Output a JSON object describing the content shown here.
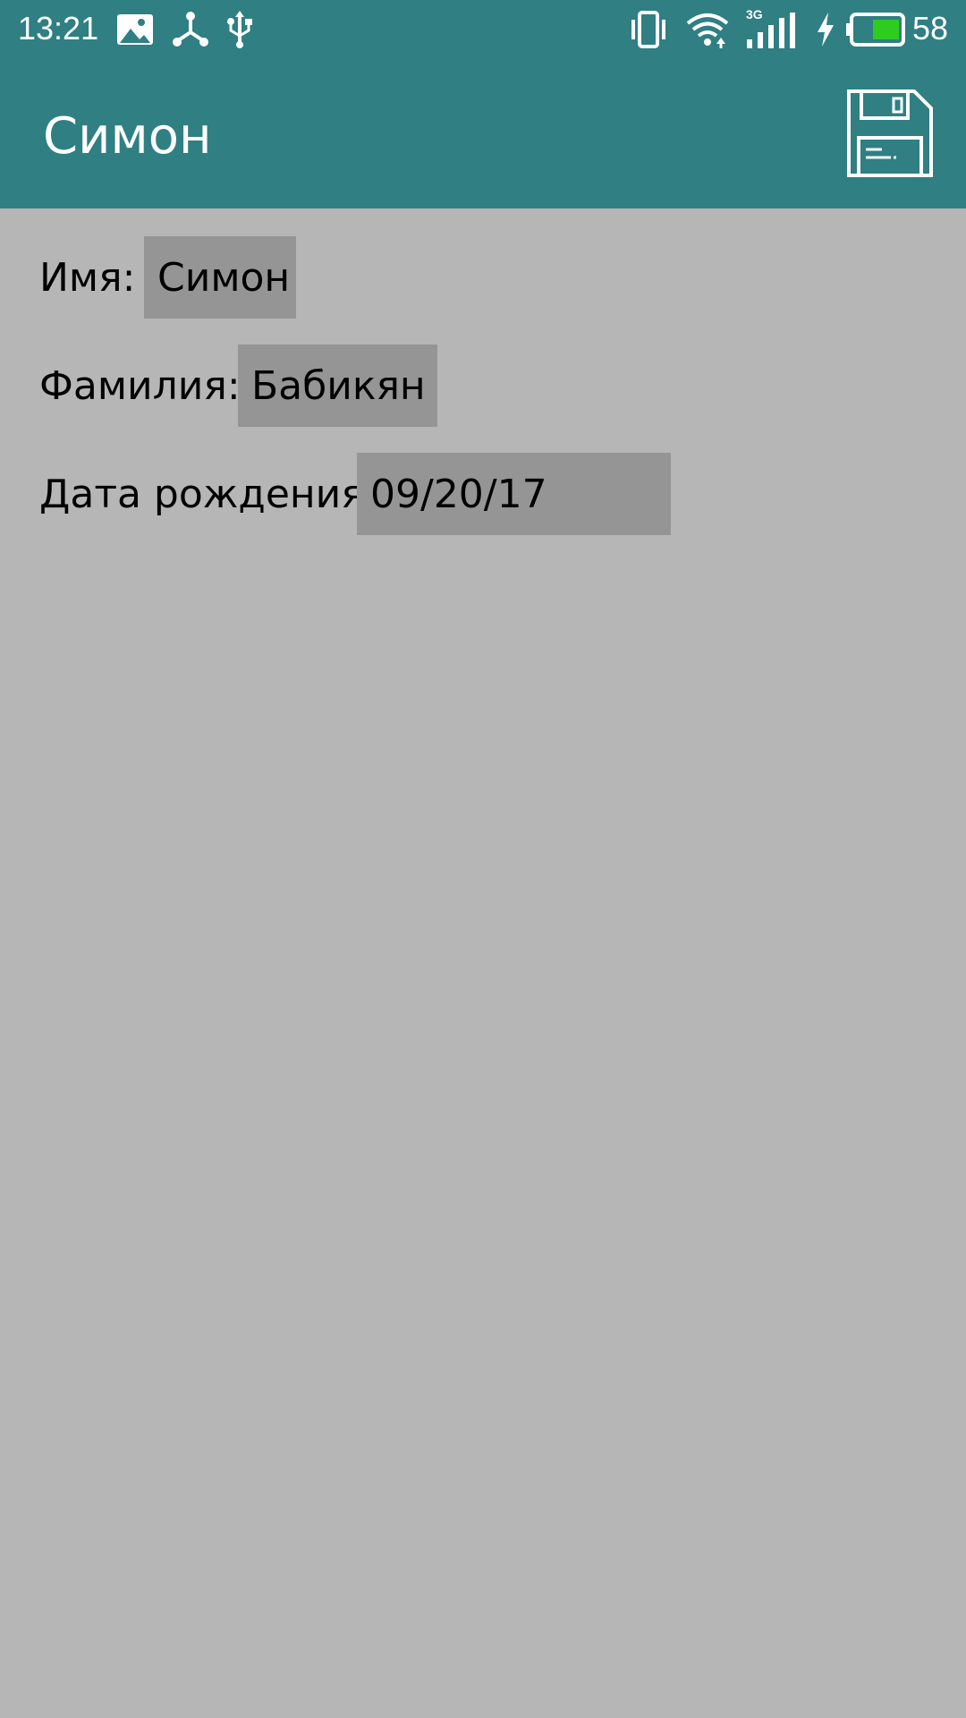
{
  "status_bar": {
    "time": "13:21",
    "network_label": "3G",
    "battery_percent": "58",
    "icons": [
      "image-icon",
      "network-share-icon",
      "usb-icon",
      "vibrate-icon",
      "wifi-icon",
      "signal-icon",
      "charging-icon",
      "battery-icon"
    ]
  },
  "toolbar": {
    "title": "Симон",
    "save_icon": "floppy-disk-icon"
  },
  "form": {
    "first_name": {
      "label": "Имя:",
      "value": "Симон"
    },
    "last_name": {
      "label": "Фамилия:",
      "value": "Бабикян"
    },
    "birth_date": {
      "label": "Дата рождения:",
      "value": "09/20/17"
    }
  },
  "colors": {
    "toolbar": "#2f7f83",
    "background": "#b6b6b6",
    "field": "#959595",
    "battery_fill": "#2ecc1f"
  }
}
